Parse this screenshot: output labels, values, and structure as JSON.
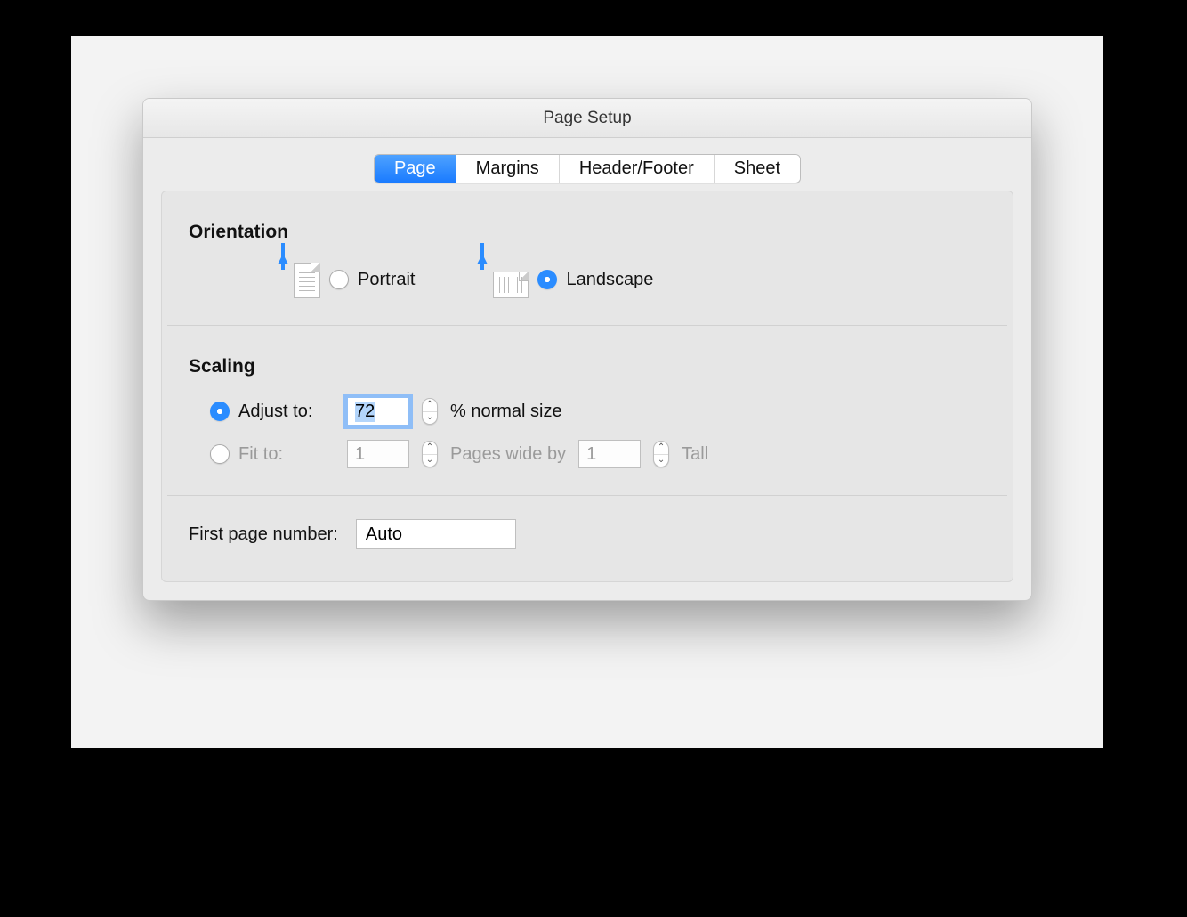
{
  "window": {
    "title": "Page Setup"
  },
  "tabs": [
    {
      "label": "Page",
      "active": true
    },
    {
      "label": "Margins",
      "active": false
    },
    {
      "label": "Header/Footer",
      "active": false
    },
    {
      "label": "Sheet",
      "active": false
    }
  ],
  "orientation": {
    "heading": "Orientation",
    "portrait_label": "Portrait",
    "landscape_label": "Landscape",
    "selected": "landscape"
  },
  "scaling": {
    "heading": "Scaling",
    "adjust_label": "Adjust to:",
    "adjust_value": "72",
    "adjust_suffix": "% normal size",
    "fit_label": "Fit to:",
    "fit_wide_value": "1",
    "fit_mid_text": "Pages wide by",
    "fit_tall_value": "1",
    "fit_tall_suffix": "Tall",
    "selected": "adjust"
  },
  "first_page": {
    "label": "First page number:",
    "value": "Auto"
  }
}
